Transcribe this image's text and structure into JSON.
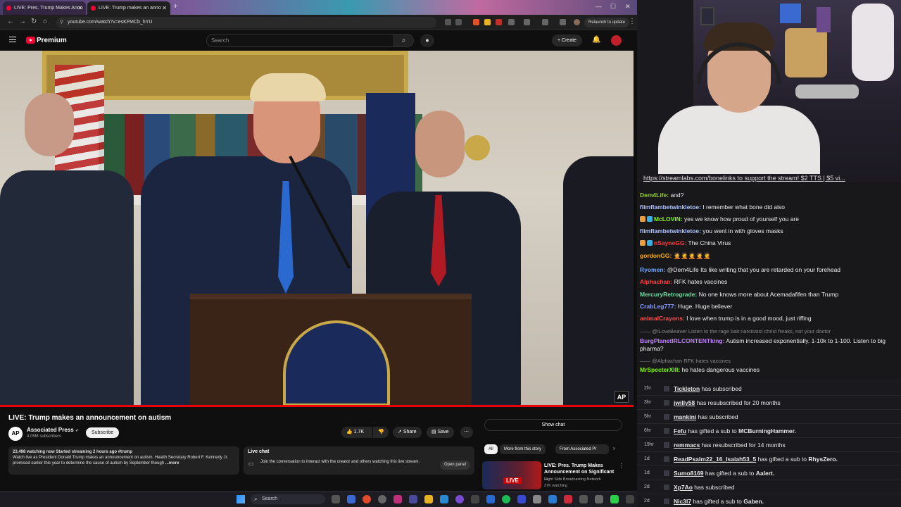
{
  "browser": {
    "tabs": [
      {
        "title": "LIVE: Pres. Trump Makes Anno"
      },
      {
        "title": "LIVE: Trump makes an anno"
      }
    ],
    "url": "youtube.com/watch?v=esKFMCb_hYU",
    "relaunch_label": "Relaunch to update"
  },
  "youtube": {
    "brand": "Premium",
    "search_placeholder": "Search",
    "create_label": "Create",
    "video": {
      "title": "LIVE: Trump makes an announcement on autism",
      "channel": "Associated Press",
      "channel_avatar": "AP",
      "subscribers": "4.05M subscribers",
      "subscribe_label": "Subscribe",
      "likes": "1.7K",
      "share_label": "Share",
      "save_label": "Save",
      "watermark": "AP",
      "stats": "23,498 watching now  Started streaming 2 hours ago  #trump",
      "description": "Watch live as President Donald Trump makes an announcement on autism. Health Secretary Robert F. Kennedy Jr. promised earlier this year to determine the cause of autism by September though",
      "more_label": "...more"
    },
    "live_chat": {
      "title": "Live chat",
      "description": "Join the conversation to interact with the creator and others watching this live stream.",
      "open_panel_label": "Open panel"
    },
    "show_chat_label": "Show chat",
    "chips": [
      "All",
      "More from this story",
      "From Associated Pr"
    ],
    "recommendation": {
      "title": "LIVE: Pres. Trump Makes Announcement on Significant ...",
      "channel": "Right Side Broadcasting Network",
      "views": "37K watching",
      "thumb_badge": "LIVE"
    }
  },
  "taskbar": {
    "search_placeholder": "Search"
  },
  "stream": {
    "promo": "https://streamlabs.com/bonelinks to support the stream! $2 TTS | $5 vi...",
    "chat": [
      {
        "user": "Dem4Life",
        "color": "#9acd32",
        "text": "and?"
      },
      {
        "user": "flimflambetwinkletoe",
        "color": "#b0c4ff",
        "text": "I remember what bone did also"
      },
      {
        "user": "McLOVIN",
        "color": "#7cfc00",
        "text": "yes we know how proud of yourself you are",
        "badges": true
      },
      {
        "user": "flimflambetwinkletoe",
        "color": "#b0c4ff",
        "text": "you went in with gloves masks"
      },
      {
        "user": "nSayneGG",
        "color": "#ff3b3b",
        "text": "The China Virus",
        "badges": true
      },
      {
        "user": "gordonGG",
        "color": "#ffb000",
        "text": "🤦🤦🤦🤦🤦"
      },
      {
        "user": "Ryomen",
        "color": "#6fa8ff",
        "text": "@Dem4Life Its like writing that you are retarded on your forehead"
      },
      {
        "user": "Alphachan",
        "color": "#ff4040",
        "text": "RFK hates vaccines"
      },
      {
        "user": "MercuryRetrograde",
        "color": "#66e0a0",
        "text": "No one knows more about Acemadafifen than Trump"
      },
      {
        "user": "CrabLeg777",
        "color": "#8a9cff",
        "text": "Huge. Huge believer"
      },
      {
        "user": "animalCrayons",
        "color": "#ff4d4d",
        "text": "I love when trump is in a good mood, just riffing"
      },
      {
        "user": "@ILoveBeaver",
        "color": "#8a8a8a",
        "text": "Listen to the rage bait narcissist christ freaks, not your doctor",
        "reply": true
      },
      {
        "user": "BurgPlanetIRLCONTENTking",
        "color": "#c080ff",
        "text": "Autism increased exponentially. 1-10k to 1-100. Listen to big pharma?"
      },
      {
        "user": "@Alphachan",
        "color": "#8a8a8a",
        "text": "RFK hates vaccines",
        "reply": true
      },
      {
        "user": "MrSpecterXIII",
        "color": "#7cfc00",
        "text": "he hates dangerous vaccines"
      }
    ],
    "events": [
      {
        "time": "2hr",
        "name": "Tickleton",
        "text": "has subscribed",
        "target": ""
      },
      {
        "time": "3hr",
        "name": "jwilly58",
        "text": "has resubscribed for 20 months",
        "target": ""
      },
      {
        "time": "5hr",
        "name": "mankini",
        "text": "has subscribed",
        "target": ""
      },
      {
        "time": "6hr",
        "name": "Fefu",
        "text": "has gifted a sub to",
        "target": "MCBurningHammer."
      },
      {
        "time": "19hr",
        "name": "remmacs",
        "text": "has resubscribed for 14 months",
        "target": ""
      },
      {
        "time": "1d",
        "name": "ReadPsalm22_16_Isaiah53_5",
        "text": "has gifted a sub to",
        "target": "RhysZero."
      },
      {
        "time": "1d",
        "name": "Sumo8169",
        "text": "has gifted a sub to",
        "target": "Aalert."
      },
      {
        "time": "2d",
        "name": "Xp7Ao",
        "text": "has subscribed",
        "target": ""
      },
      {
        "time": "2d",
        "name": "Nic3l7",
        "text": "has gifted a sub to",
        "target": "Gaben."
      }
    ]
  }
}
